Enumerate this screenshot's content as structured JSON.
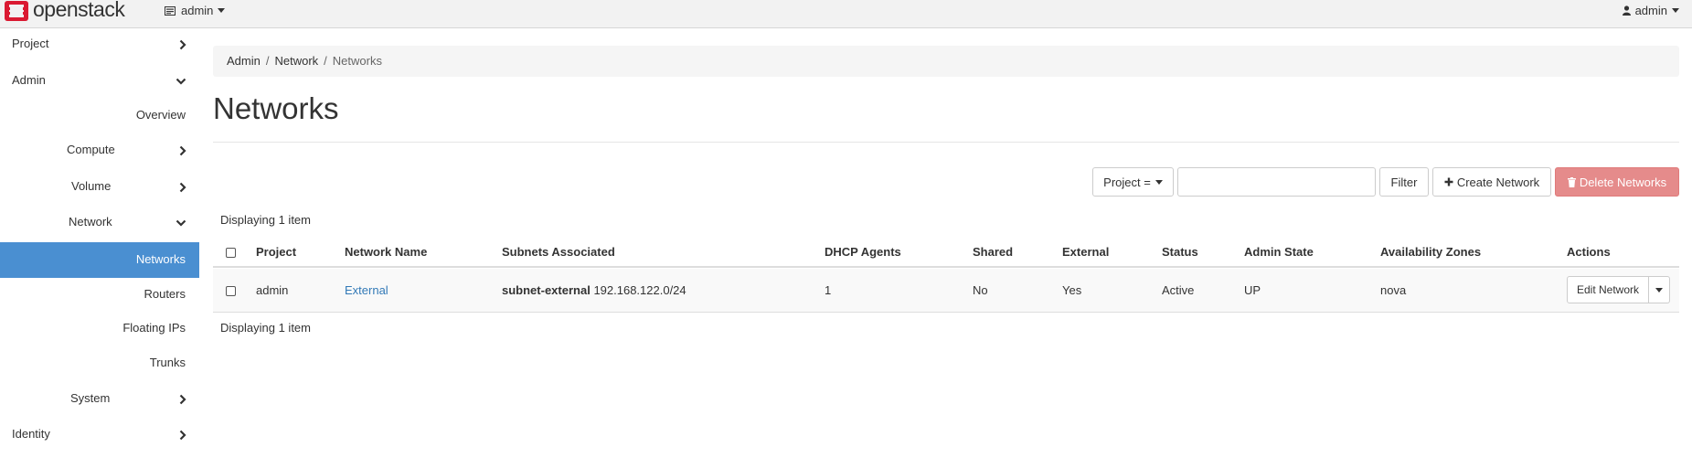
{
  "brand": {
    "name": "openstack",
    "logo_color": "#da1a32"
  },
  "topbar": {
    "project_label": "admin",
    "user_label": "admin"
  },
  "sidebar": {
    "items": [
      {
        "label": "Project"
      },
      {
        "label": "Admin"
      },
      {
        "label": "Overview"
      },
      {
        "label": "Compute"
      },
      {
        "label": "Volume"
      },
      {
        "label": "Network"
      },
      {
        "label": "Networks"
      },
      {
        "label": "Routers"
      },
      {
        "label": "Floating IPs"
      },
      {
        "label": "Trunks"
      },
      {
        "label": "System"
      },
      {
        "label": "Identity"
      }
    ],
    "active_color": "#4a8fd1"
  },
  "breadcrumb": {
    "items": [
      "Admin",
      "Network",
      "Networks"
    ]
  },
  "page": {
    "title": "Networks"
  },
  "toolbar": {
    "filter_field": "Project =",
    "filter_value": "",
    "filter_button": "Filter",
    "create_button": "Create Network",
    "delete_button": "Delete Networks"
  },
  "table": {
    "summary_top": "Displaying 1 item",
    "summary_bottom": "Displaying 1 item",
    "columns": [
      "Project",
      "Network Name",
      "Subnets Associated",
      "DHCP Agents",
      "Shared",
      "External",
      "Status",
      "Admin State",
      "Availability Zones",
      "Actions"
    ],
    "rows": [
      {
        "project": "admin",
        "network_name": "External",
        "subnet_name": "subnet-external",
        "subnet_cidr": "192.168.122.0/24",
        "dhcp_agents": "1",
        "shared": "No",
        "external": "Yes",
        "status": "Active",
        "admin_state": "UP",
        "availability_zones": "nova",
        "action_label": "Edit Network"
      }
    ]
  }
}
